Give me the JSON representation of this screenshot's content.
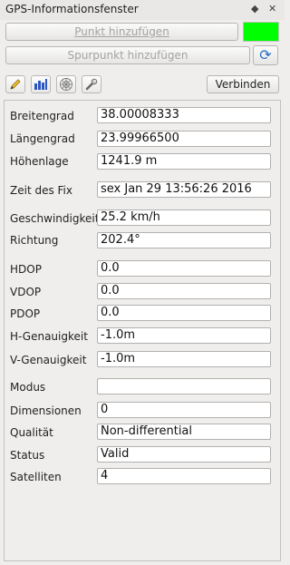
{
  "window": {
    "title": "GPS-Informationsfenster",
    "float_icon": "◆",
    "close_icon": "✕"
  },
  "buttons": {
    "add_point": "Punkt hinzufügen",
    "add_track_point": "Spurpunkt hinzufügen",
    "connect": "Verbinden"
  },
  "status_color": "#00ff00",
  "toolbar": {
    "tools": [
      {
        "name": "position-tool",
        "icon": "pencil-icon"
      },
      {
        "name": "signal-tool",
        "icon": "bar-chart-icon"
      },
      {
        "name": "satellite-tool",
        "icon": "polar-plot-icon"
      },
      {
        "name": "options-tool",
        "icon": "wrench-icon"
      }
    ]
  },
  "fields": [
    {
      "label": "Breitengrad",
      "value": "38.00008333"
    },
    {
      "label": "Längengrad",
      "value": "23.99966500"
    },
    {
      "label": "Höhenlage",
      "value": "1241.9 m"
    },
    {
      "label": "Zeit des Fix",
      "value": "sex Jan 29 13:56:26 2016"
    },
    {
      "label": "Geschwindigkeit",
      "value": "25.2 km/h"
    },
    {
      "label": "Richtung",
      "value": "202.4°"
    },
    {
      "label": "HDOP",
      "value": "0.0"
    },
    {
      "label": "VDOP",
      "value": "0.0"
    },
    {
      "label": "PDOP",
      "value": "0.0"
    },
    {
      "label": "H-Genauigkeit",
      "value": "-1.0m"
    },
    {
      "label": "V-Genauigkeit",
      "value": "-1.0m"
    },
    {
      "label": "Modus",
      "value": ""
    },
    {
      "label": "Dimensionen",
      "value": "0"
    },
    {
      "label": "Qualität",
      "value": "Non-differential"
    },
    {
      "label": "Status",
      "value": "Valid"
    },
    {
      "label": "Satelliten",
      "value": "4"
    }
  ]
}
